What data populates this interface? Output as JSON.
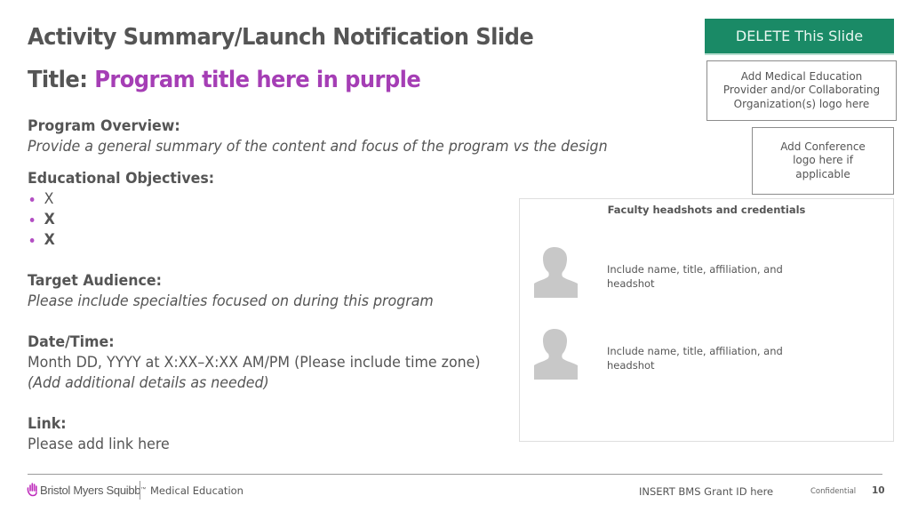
{
  "slide": {
    "heading": "Activity Summary/Launch Notification Slide",
    "title_label": "Title:",
    "title_value": "Program title here in purple",
    "accent_color": "#a53eb5"
  },
  "overview": {
    "heading": "Program Overview:",
    "text": "Provide a general summary of the content and focus of the program vs the design"
  },
  "objectives": {
    "heading": "Educational Objectives:",
    "items": [
      "X",
      "X",
      "X"
    ]
  },
  "audience": {
    "heading": "Target Audience:",
    "text": "Please include specialties focused on during this program"
  },
  "datetime": {
    "heading": "Date/Time:",
    "text": "Month DD, YYYY at X:XX–X:XX AM/PM (Please include time zone)",
    "note": "(Add additional details as needed)"
  },
  "link": {
    "heading": "Link:",
    "text": "Please add link here"
  },
  "delete_button": {
    "label": "DELETE This Slide",
    "color": "#1a8a66"
  },
  "provider_logo": {
    "text": "Add Medical Education Provider and/or Collaborating Organization(s) logo here"
  },
  "conference_logo": {
    "text": "Add Conference logo here if applicable"
  },
  "faculty": {
    "title": "Faculty headshots and credentials",
    "members": [
      {
        "icon": "person-silhouette-icon",
        "text": "Include name, title, affiliation, and headshot"
      },
      {
        "icon": "person-silhouette-icon",
        "text": "Include name, title, affiliation, and headshot"
      }
    ]
  },
  "footer": {
    "brand": "Bristol Myers Squibb",
    "brand_mark": "™",
    "department": "Medical Education",
    "grant_id": "INSERT BMS Grant ID here",
    "confidential": "Confidential",
    "page_number": "10"
  }
}
